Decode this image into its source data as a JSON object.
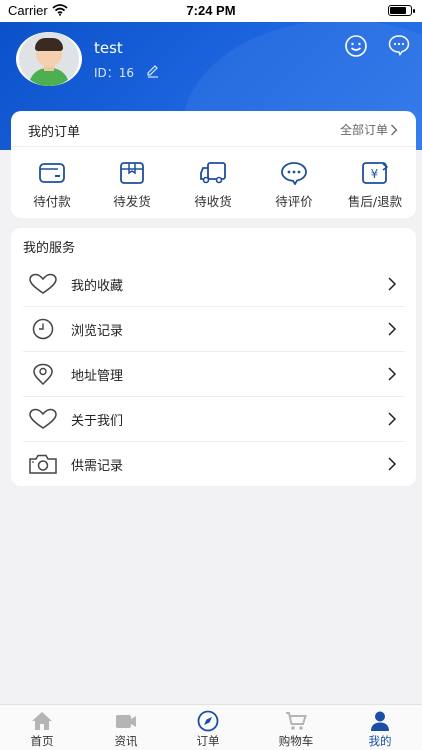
{
  "status_bar": {
    "carrier": "Carrier",
    "time": "7:24 PM"
  },
  "profile": {
    "username": "test",
    "id_label": "ID：16"
  },
  "orders": {
    "title": "我的订单",
    "all_label": "全部订单",
    "items": [
      {
        "label": "待付款",
        "icon": "wallet-icon"
      },
      {
        "label": "待发货",
        "icon": "package-icon"
      },
      {
        "label": "待收货",
        "icon": "truck-icon"
      },
      {
        "label": "待评价",
        "icon": "chat-bubble-icon"
      },
      {
        "label": "售后/退款",
        "icon": "refund-icon"
      }
    ]
  },
  "services": {
    "title": "我的服务",
    "items": [
      {
        "label": "我的收藏",
        "icon": "heart-icon"
      },
      {
        "label": "浏览记录",
        "icon": "clock-icon"
      },
      {
        "label": "地址管理",
        "icon": "location-pin-icon"
      },
      {
        "label": "关于我们",
        "icon": "heart-icon"
      },
      {
        "label": "供需记录",
        "icon": "camera-icon"
      }
    ]
  },
  "tabbar": {
    "items": [
      {
        "label": "首页",
        "icon": "home-icon"
      },
      {
        "label": "资讯",
        "icon": "video-icon"
      },
      {
        "label": "订单",
        "icon": "compass-icon"
      },
      {
        "label": "购物车",
        "icon": "cart-icon"
      },
      {
        "label": "我的",
        "icon": "user-icon"
      }
    ],
    "active": "我的"
  },
  "colors": {
    "primary": "#0a4fc7",
    "active_tab": "#1a4fa8",
    "icon_blue": "#1f4f9c",
    "inactive_tab": "#b5b5b5"
  }
}
